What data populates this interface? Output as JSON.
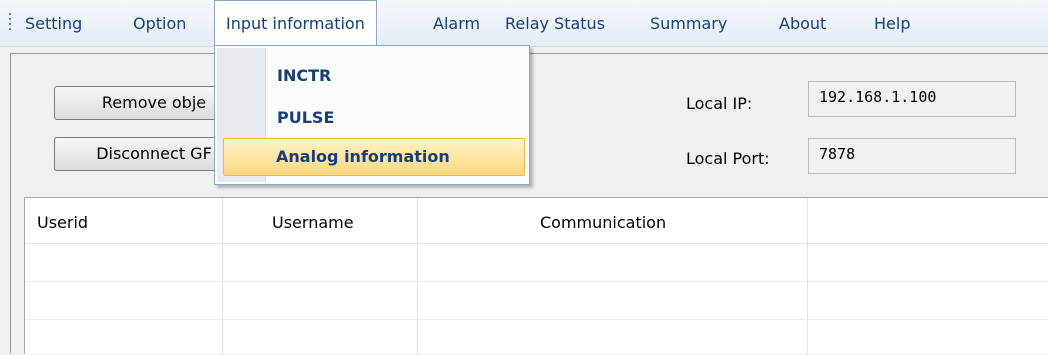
{
  "menubar": {
    "items": [
      "Setting",
      "Option",
      "Input information",
      "Alarm",
      "Relay Status",
      "Summary",
      "About",
      "Help"
    ]
  },
  "dropdown": {
    "items": [
      "INCTR",
      "PULSE",
      "Analog information"
    ],
    "highlighted": "Analog information"
  },
  "toolbar": {
    "remove_label": "Remove  obje",
    "disconnect_label": "Disconnect GF"
  },
  "network": {
    "ip_label": "Local   IP:",
    "ip_value": "192.168.1.100",
    "port_label": "Local  Port:",
    "port_value": "7878"
  },
  "table": {
    "columns": [
      "Userid",
      "Username",
      "Communication",
      ""
    ],
    "rows": []
  },
  "colors": {
    "menu_text": "#1a3e78",
    "highlight": "#fbd77e"
  }
}
